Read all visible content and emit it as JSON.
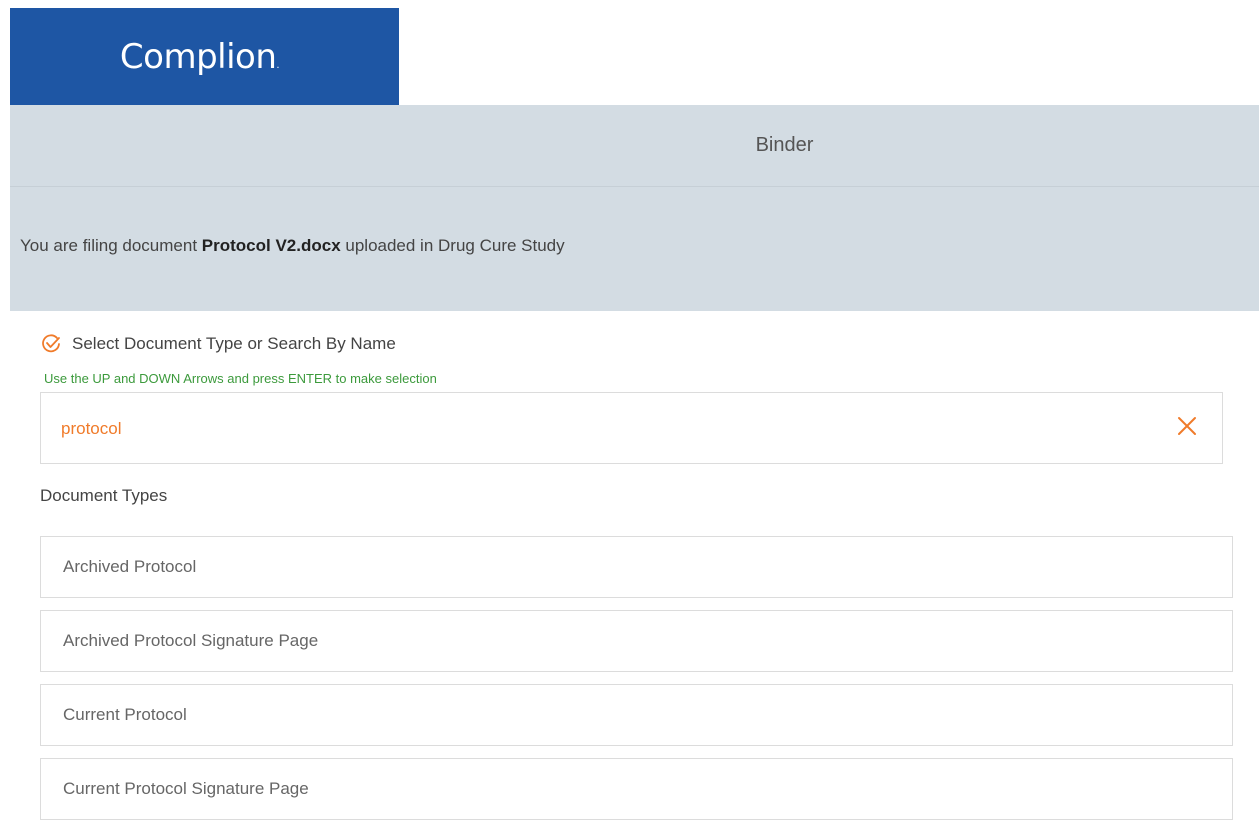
{
  "brand": {
    "logo_text": "Complion",
    "logo_suffix": ".",
    "color": "#1e56a4"
  },
  "header": {
    "title": "Binder"
  },
  "filing": {
    "prefix": "You are filing document ",
    "document_name": "Protocol V2.docx",
    "suffix": " uploaded in Drug Cure Study"
  },
  "selector": {
    "label": "Select Document Type or Search By Name",
    "label_icon": "check-circle-icon",
    "hint": "Use the UP and DOWN Arrows and press ENTER to make selection",
    "search_value": "protocol",
    "clear_icon": "close-icon",
    "accent_color": "#f07b2a"
  },
  "document_types": {
    "title": "Document Types",
    "items": [
      {
        "label": "Archived Protocol"
      },
      {
        "label": "Archived Protocol Signature Page"
      },
      {
        "label": "Current Protocol"
      },
      {
        "label": "Current Protocol Signature Page"
      }
    ]
  }
}
